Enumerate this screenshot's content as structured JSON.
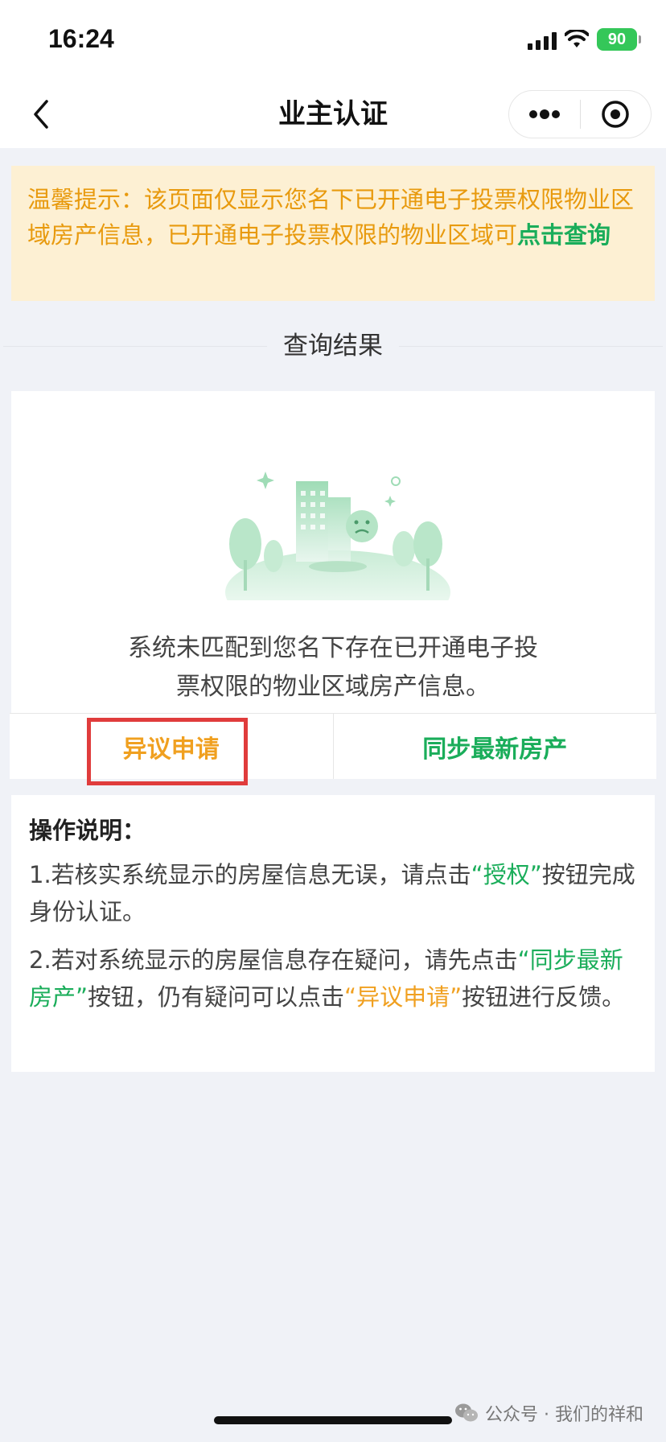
{
  "status_bar": {
    "time": "16:24",
    "battery": "90"
  },
  "nav": {
    "title": "业主认证",
    "back_icon": "chevron-left-icon",
    "more_icon": "more-dots-icon",
    "close_icon": "target-circle-icon"
  },
  "notice": {
    "text": "温馨提示：该页面仅显示您名下已开通电子投票权限物业区域房产信息，已开通电子投票权限的物业区域可",
    "link": "点击查询"
  },
  "section": {
    "title": "查询结果"
  },
  "result": {
    "illustration_icon": "no-house-illustration",
    "empty_line1": "系统未匹配到您名下存在已开通电子投",
    "empty_line2": "票权限的物业区域房产信息。"
  },
  "actions": {
    "objection": "异议申请",
    "sync": "同步最新房产"
  },
  "instructions": {
    "title": "操作说明：",
    "p1_a": "1.若核实系统显示的房屋信息无误，请点击",
    "p1_g": "“授权”",
    "p1_b": "按钮完成身份认证。",
    "p2_a": "2.若对系统显示的房屋信息存在疑问，请先点击",
    "p2_g": "“同步最新房产”",
    "p2_b": "按钮，仍有疑问可以点击",
    "p2_o": "“异议申请”",
    "p2_c": "按钮进行反馈。"
  },
  "watermark": {
    "text": "公众号 · 我们的祥和",
    "icon": "wechat-icon"
  },
  "colors": {
    "green": "#1aad5a",
    "orange": "#f0a020",
    "notice_bg": "#fdf0d3",
    "highlight": "#e03c3c"
  }
}
